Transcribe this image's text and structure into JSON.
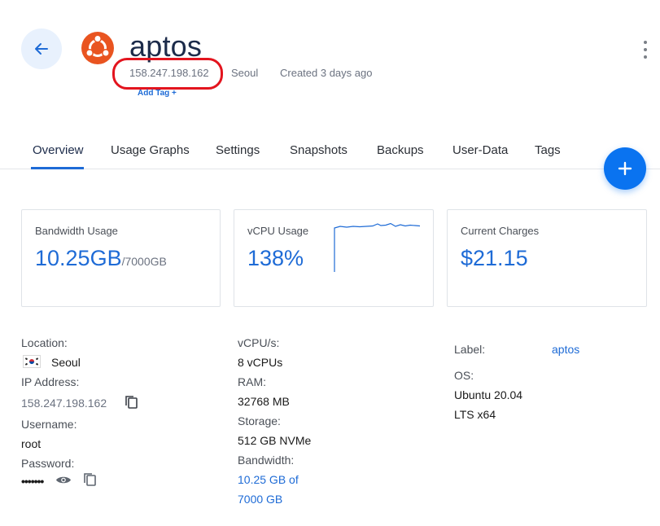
{
  "header": {
    "title": "aptos",
    "ip": "158.247.198.162",
    "location": "Seoul",
    "created": "Created 3 days ago",
    "add_tag": "Add Tag +"
  },
  "tabs": [
    {
      "label": "Overview",
      "active": true
    },
    {
      "label": "Usage Graphs",
      "active": false
    },
    {
      "label": "Settings",
      "active": false
    },
    {
      "label": "Snapshots",
      "active": false
    },
    {
      "label": "Backups",
      "active": false
    },
    {
      "label": "User-Data",
      "active": false
    },
    {
      "label": "Tags",
      "active": false
    }
  ],
  "cards": {
    "bandwidth": {
      "title": "Bandwidth Usage",
      "value": "10.25GB",
      "unit": "/7000GB"
    },
    "vcpu": {
      "title": "vCPU Usage",
      "value": "138%"
    },
    "charges": {
      "title": "Current Charges",
      "value": "$21.15"
    }
  },
  "details": {
    "location_label": "Location:",
    "location_value": "Seoul",
    "ip_label": "IP Address:",
    "ip_value": "158.247.198.162",
    "username_label": "Username:",
    "username_value": "root",
    "password_label": "Password:",
    "password_value": "•••••••",
    "vcpu_label": "vCPU/s:",
    "vcpu_value": "8 vCPUs",
    "ram_label": "RAM:",
    "ram_value": "32768 MB",
    "storage_label": "Storage:",
    "storage_value": "512 GB NVMe",
    "bandwidth_label": "Bandwidth:",
    "bandwidth_value_line1": "10.25 GB of",
    "bandwidth_value_line2": "7000 GB",
    "label_label": "Label:",
    "label_value": "aptos",
    "os_label": "OS:",
    "os_value_line1": "Ubuntu 20.04",
    "os_value_line2": "LTS x64"
  },
  "colors": {
    "accent": "#1e6bd6",
    "fab": "#0a73f0",
    "highlight": "#e3141e",
    "ubuntu": "#e95420"
  },
  "icons": {
    "back": "arrow-left-icon",
    "os": "ubuntu-logo-icon",
    "menu": "kebab-menu-icon",
    "fab": "plus-icon",
    "copy": "copy-icon",
    "view": "eye-icon",
    "flag": "south-korea-flag-icon"
  }
}
